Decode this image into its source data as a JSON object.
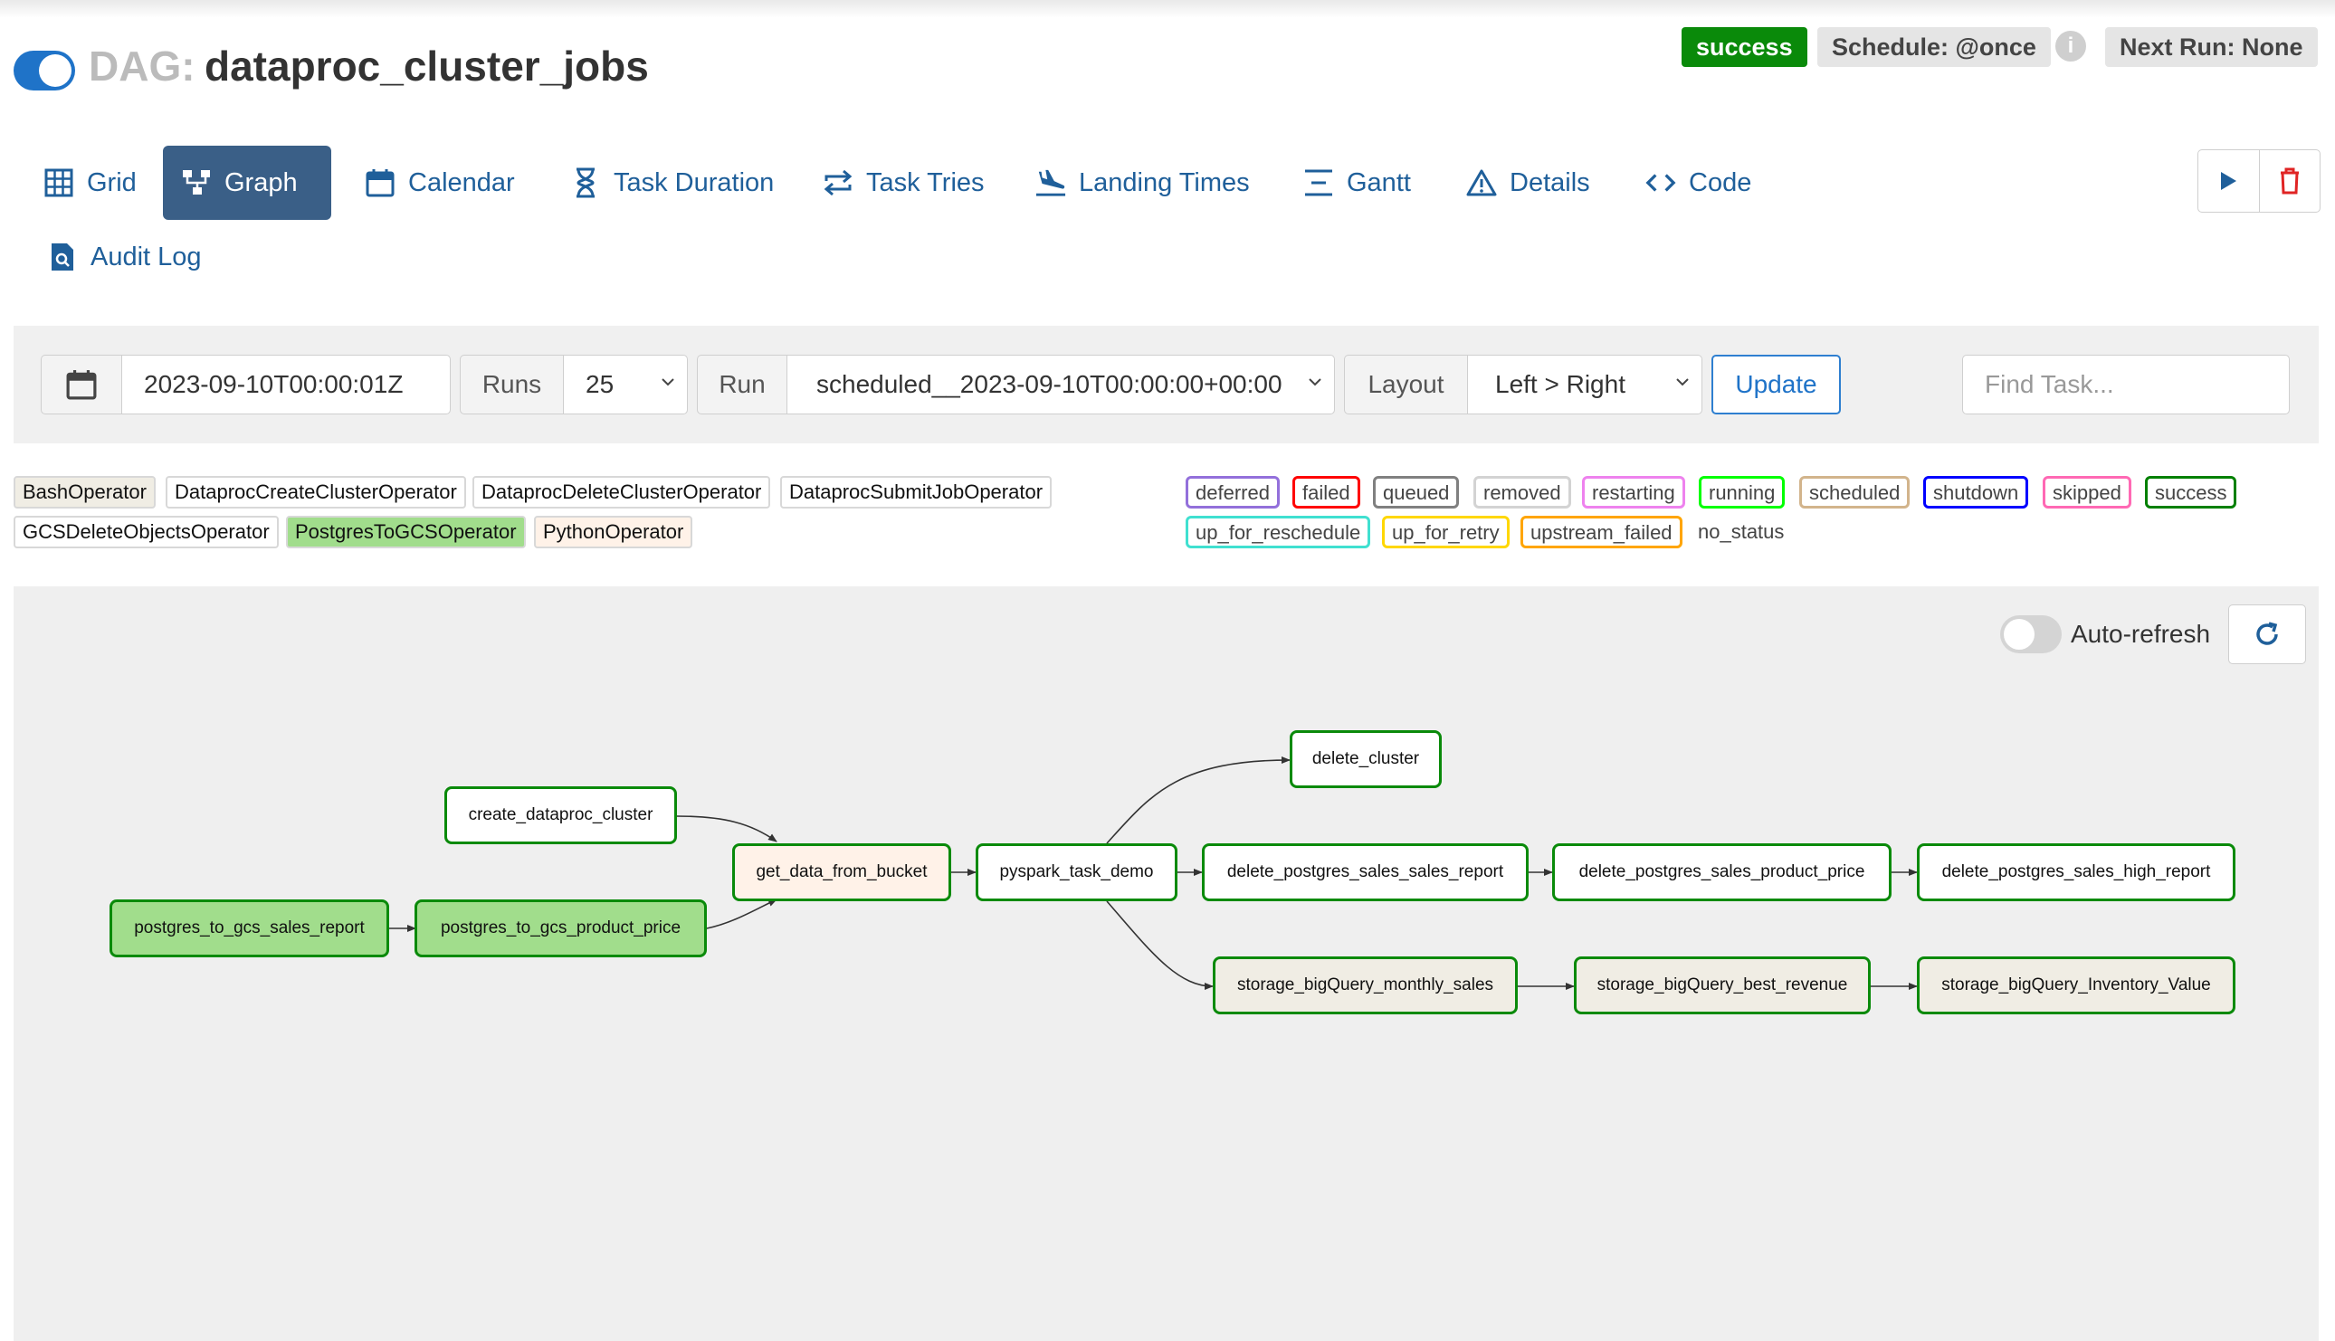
{
  "header": {
    "dag_prefix": "DAG:",
    "dag_id": "dataproc_cluster_jobs",
    "state_badge": "success",
    "schedule": "Schedule: @once",
    "next_run": "Next Run: None",
    "info_icon": "i"
  },
  "tabs": [
    {
      "label": "Grid",
      "icon": "grid-icon"
    },
    {
      "label": "Graph",
      "icon": "graph-icon",
      "active": true
    },
    {
      "label": "Calendar",
      "icon": "calendar-icon"
    },
    {
      "label": "Task Duration",
      "icon": "hourglass-icon"
    },
    {
      "label": "Task Tries",
      "icon": "repeat-icon"
    },
    {
      "label": "Landing Times",
      "icon": "plane-landing-icon"
    },
    {
      "label": "Gantt",
      "icon": "gantt-icon"
    },
    {
      "label": "Details",
      "icon": "warning-triangle-icon"
    },
    {
      "label": "Code",
      "icon": "code-icon"
    },
    {
      "label": "Audit Log",
      "icon": "file-search-icon"
    }
  ],
  "controls": {
    "date": "2023-09-10T00:00:01Z",
    "runs_label": "Runs",
    "runs_value": "25",
    "run_label": "Run",
    "run_value": "scheduled__2023-09-10T00:00:00+00:00",
    "layout_label": "Layout",
    "layout_value": "Left > Right",
    "update": "Update",
    "find_placeholder": "Find Task..."
  },
  "operators": [
    {
      "name": "BashOperator",
      "color": "#f0ede4"
    },
    {
      "name": "DataprocCreateClusterOperator",
      "color": "#ffffff"
    },
    {
      "name": "DataprocDeleteClusterOperator",
      "color": "#ffffff"
    },
    {
      "name": "DataprocSubmitJobOperator",
      "color": "#ffffff"
    },
    {
      "name": "GCSDeleteObjectsOperator",
      "color": "#ffffff"
    },
    {
      "name": "PostgresToGCSOperator",
      "color": "#a1dd8c"
    },
    {
      "name": "PythonOperator",
      "color": "#fff2e8"
    }
  ],
  "states": [
    {
      "name": "deferred",
      "color": "#9370db"
    },
    {
      "name": "failed",
      "color": "#ff0000"
    },
    {
      "name": "queued",
      "color": "#808080"
    },
    {
      "name": "removed",
      "color": "#d3d3d3"
    },
    {
      "name": "restarting",
      "color": "#ee82ee"
    },
    {
      "name": "running",
      "color": "#00ff00"
    },
    {
      "name": "scheduled",
      "color": "#d2b48c"
    },
    {
      "name": "shutdown",
      "color": "#0000ff"
    },
    {
      "name": "skipped",
      "color": "#ff69b4"
    },
    {
      "name": "success",
      "color": "#008000"
    },
    {
      "name": "up_for_reschedule",
      "color": "#40e0d0"
    },
    {
      "name": "up_for_retry",
      "color": "#ffd700"
    },
    {
      "name": "upstream_failed",
      "color": "#ffa500"
    },
    {
      "name": "no_status",
      "color": ""
    }
  ],
  "graph": {
    "auto_refresh": "Auto-refresh",
    "tasks": {
      "create_dataproc_cluster": "create_dataproc_cluster",
      "postgres_to_gcs_sales_report": "postgres_to_gcs_sales_report",
      "postgres_to_gcs_product_price": "postgres_to_gcs_product_price",
      "get_data_from_bucket": "get_data_from_bucket",
      "pyspark_task_demo": "pyspark_task_demo",
      "delete_cluster": "delete_cluster",
      "delete_postgres_sales_sales_report": "delete_postgres_sales_sales_report",
      "delete_postgres_sales_product_price": "delete_postgres_sales_product_price",
      "delete_postgres_sales_high_report": "delete_postgres_sales_high_report",
      "storage_bigQuery_monthly_sales": "storage_bigQuery_monthly_sales",
      "storage_bigQuery_best_revenue": "storage_bigQuery_best_revenue",
      "storage_bigQuery_Inventory_Value": "storage_bigQuery_Inventory_Value"
    },
    "task_colors": {
      "dataproc": "#ffffff",
      "postgres_to_gcs": "#a1dd8c",
      "python": "#fff2e8",
      "bash": "#f0ede4"
    }
  }
}
